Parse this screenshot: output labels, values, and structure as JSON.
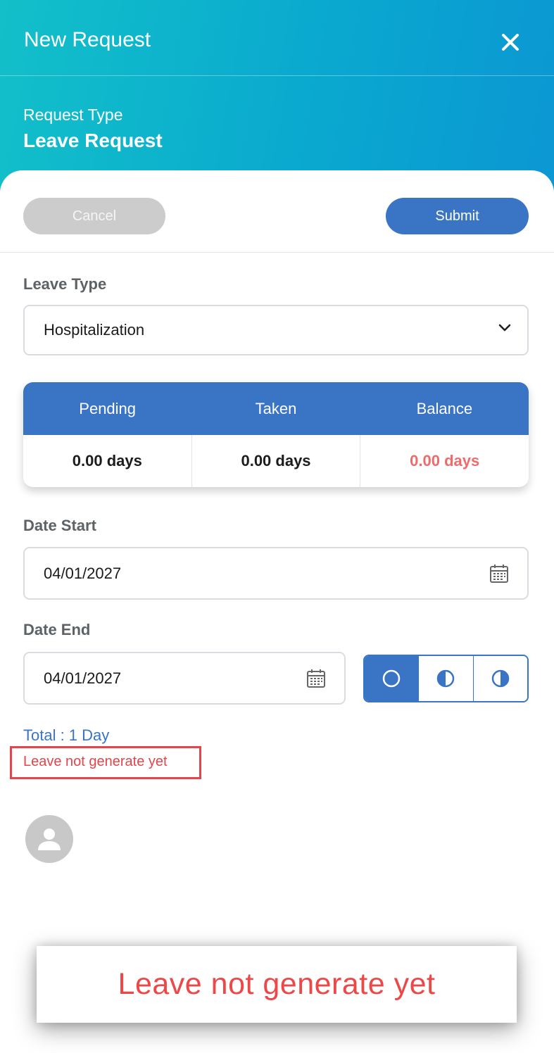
{
  "header": {
    "title": "New Request",
    "request_type_label": "Request Type",
    "request_type_value": "Leave Request"
  },
  "actions": {
    "cancel_label": "Cancel",
    "submit_label": "Submit"
  },
  "leave_type": {
    "label": "Leave Type",
    "selected": "Hospitalization"
  },
  "balance": {
    "headers": [
      "Pending",
      "Taken",
      "Balance"
    ],
    "values": [
      "0.00 days",
      "0.00 days",
      "0.00 days"
    ]
  },
  "date_start": {
    "label": "Date Start",
    "value": "04/01/2027"
  },
  "date_end": {
    "label": "Date End",
    "value": "04/01/2027"
  },
  "day_portion": {
    "options": [
      "full-day-icon",
      "first-half-icon",
      "second-half-icon"
    ],
    "selected_index": 0
  },
  "summary": {
    "total": "Total : 1 Day",
    "error": "Leave not generate yet"
  },
  "toast": {
    "message": "Leave not generate yet"
  },
  "colors": {
    "header_gradient_start": "#12c0c9",
    "header_gradient_end": "#0b97d3",
    "primary": "#3a74c5",
    "error": "#e2454b",
    "balance_value": "#ee6b6b"
  }
}
